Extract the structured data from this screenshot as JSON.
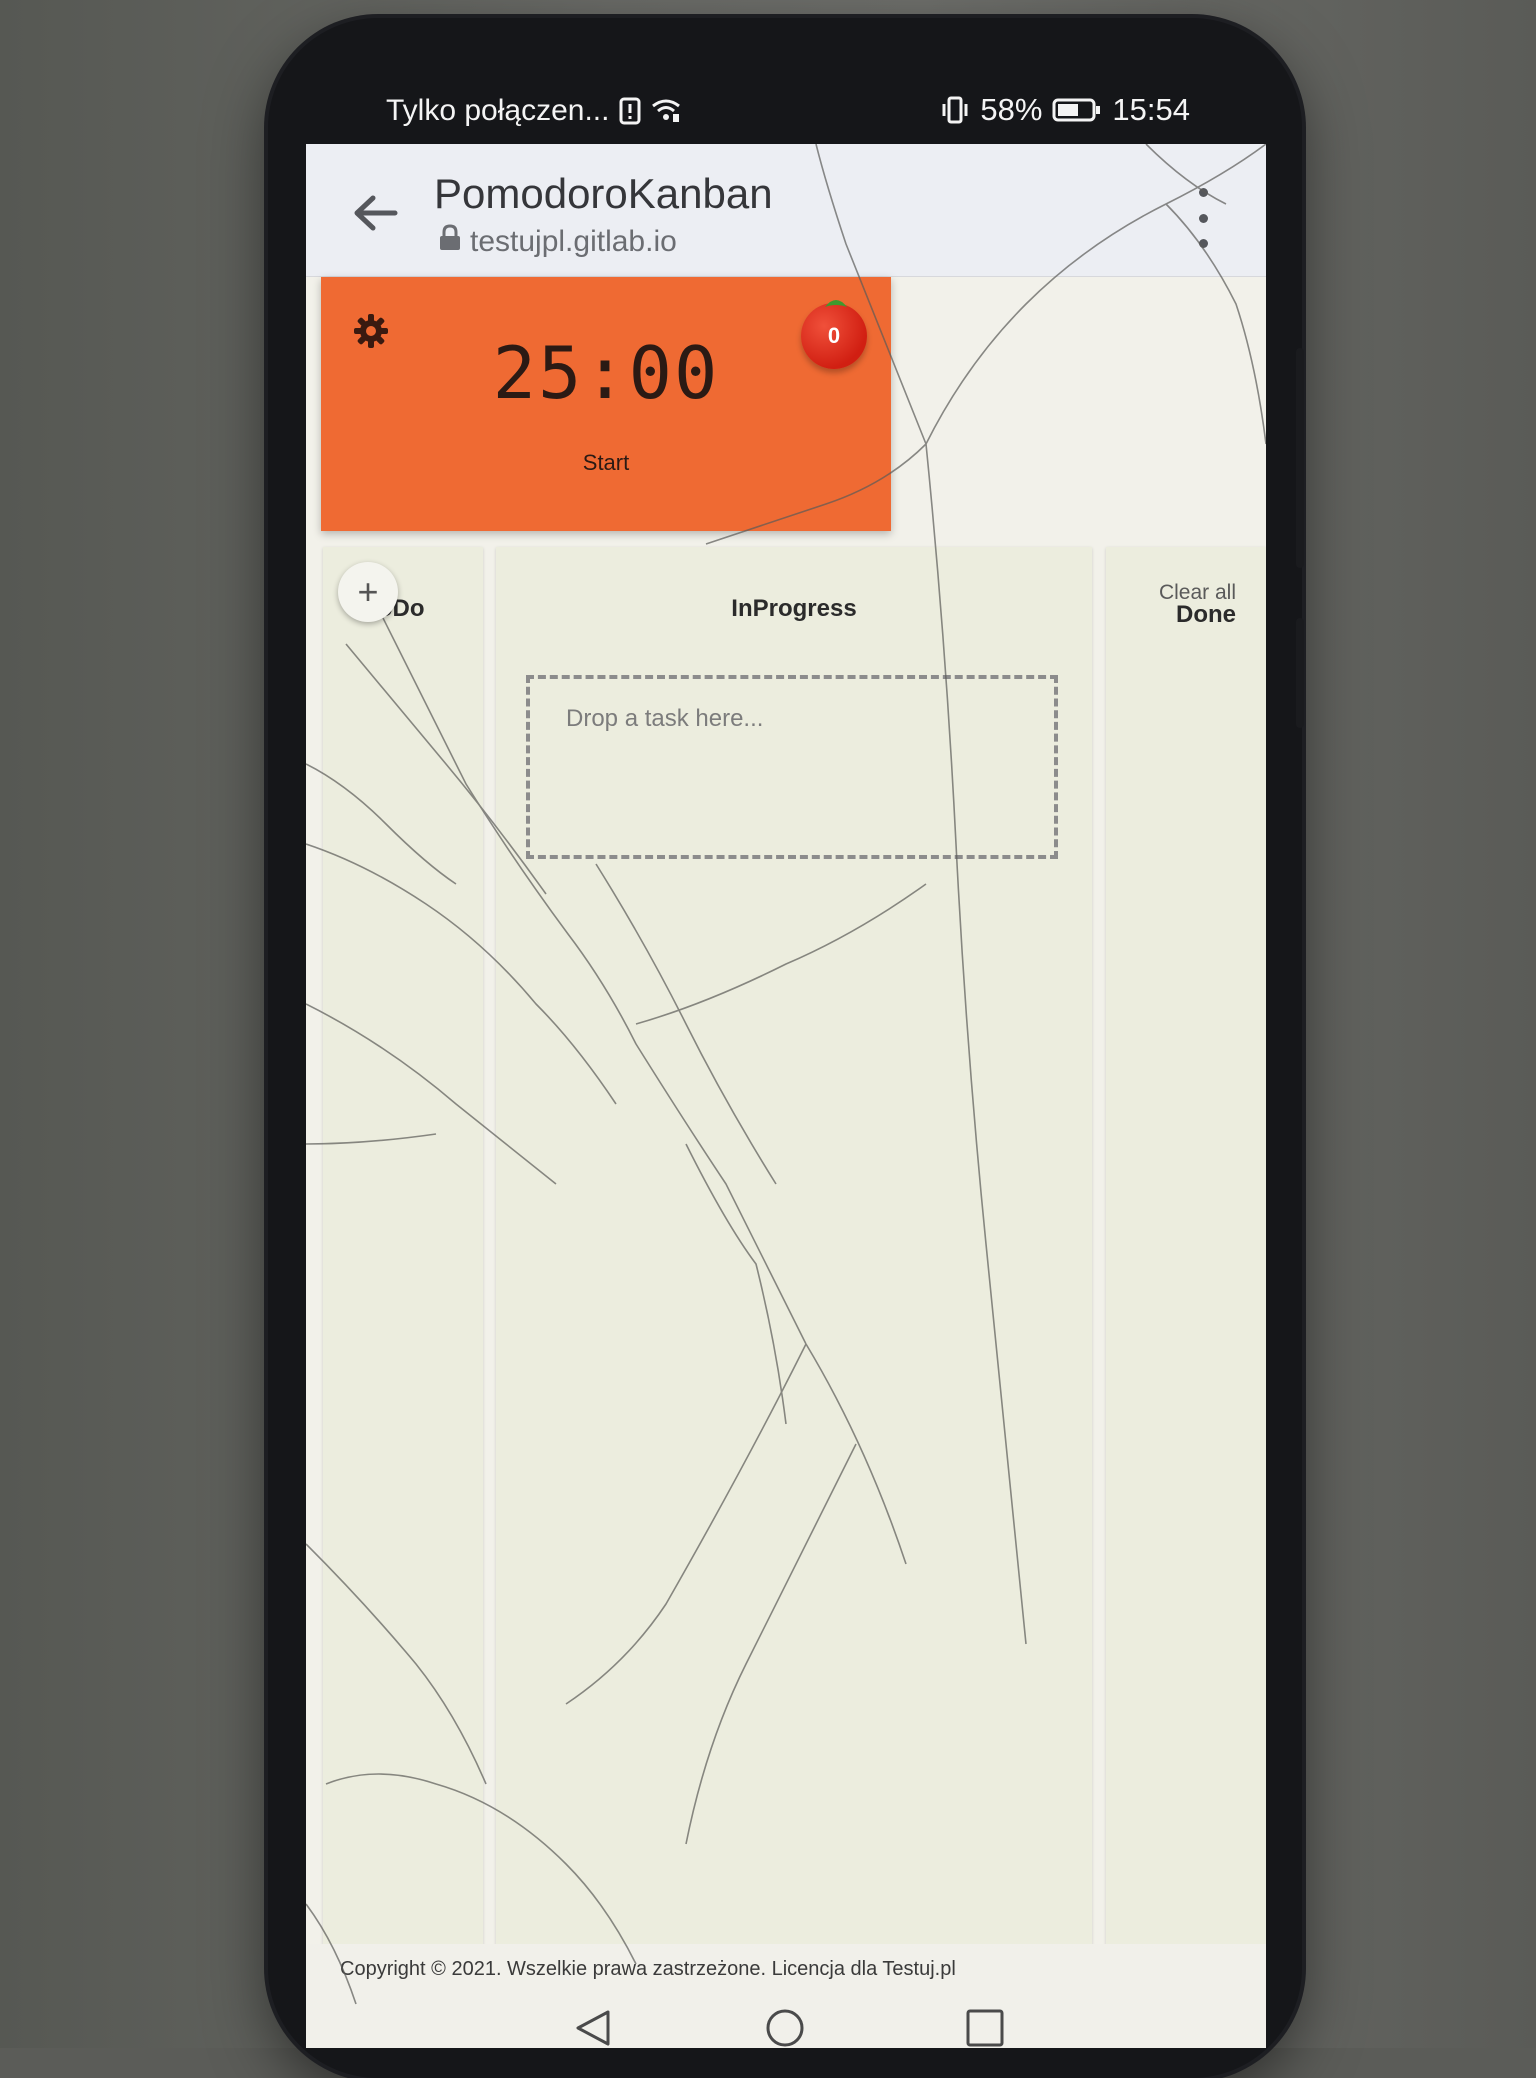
{
  "status_bar": {
    "carrier": "Tylko połączen...",
    "battery_percent": "58%",
    "time": "15:54"
  },
  "browser": {
    "page_title": "PomodoroKanban",
    "domain": "testujpl.gitlab.io"
  },
  "timer": {
    "display": "25:00",
    "start_label": "Start",
    "pomodoro_count": "0"
  },
  "board": {
    "columns": [
      {
        "title": "ToDo"
      },
      {
        "title": "InProgress"
      },
      {
        "title": "Done"
      }
    ],
    "drop_placeholder": "Drop a task here...",
    "clear_all_label": "Clear all",
    "add_label": "+"
  },
  "footer": {
    "copyright": "Copyright © 2021. Wszelkie prawa zastrzeżone. Licencja dla Testuj.pl"
  },
  "colors": {
    "timer_bg": "#ef6a33",
    "tomato": "#d11f12",
    "column_bg": "#ecedde"
  }
}
